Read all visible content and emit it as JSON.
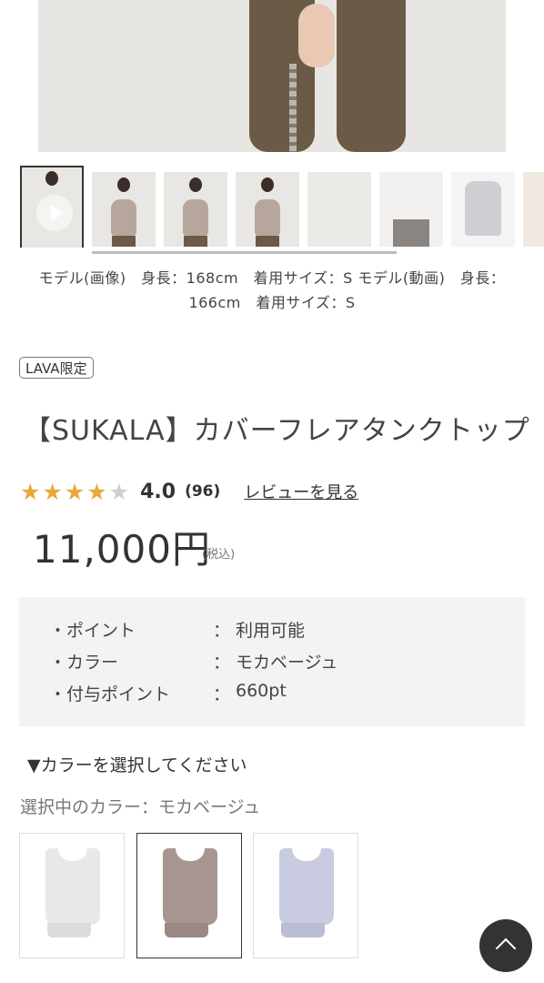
{
  "gallery": {
    "thumbnails": [
      "video",
      "front",
      "back",
      "side",
      "neck-detail",
      "hem-detail",
      "bra-detail",
      "more"
    ],
    "caption": "モデル(画像)　身長：168cm　着用サイズ：S モデル(動画)　身長：166cm　着用サイズ：S"
  },
  "product": {
    "badge": "LAVA限定",
    "title": "【SUKALA】カバーフレアタンクトップ",
    "rating": {
      "stars": "★★★★",
      "empty_star": "★",
      "score": "4.0",
      "count": "(96)",
      "review_link": "レビューを見る",
      "value": 4.0,
      "max": 5
    },
    "price": "11,000円",
    "tax_note": "(税込)"
  },
  "info": {
    "separator": "：",
    "rows": [
      {
        "label": "・ポイント",
        "value": "利用可能"
      },
      {
        "label": "・カラー",
        "value": "モカベージュ"
      },
      {
        "label": "・付与ポイント",
        "value": "660pt"
      }
    ]
  },
  "color_select": {
    "heading": "▼カラーを選択してください",
    "current": "選択中のカラー：モカベージュ",
    "swatches": [
      {
        "name": "white",
        "color": "#e8e8ea"
      },
      {
        "name": "mocha-beige",
        "color": "#a89591",
        "selected": true
      },
      {
        "name": "lavender",
        "color": "#c9cbe0"
      }
    ]
  },
  "colors": {
    "star": "#e9a93a",
    "info_bg": "#f3f3f3",
    "fab_bg": "#333333"
  }
}
